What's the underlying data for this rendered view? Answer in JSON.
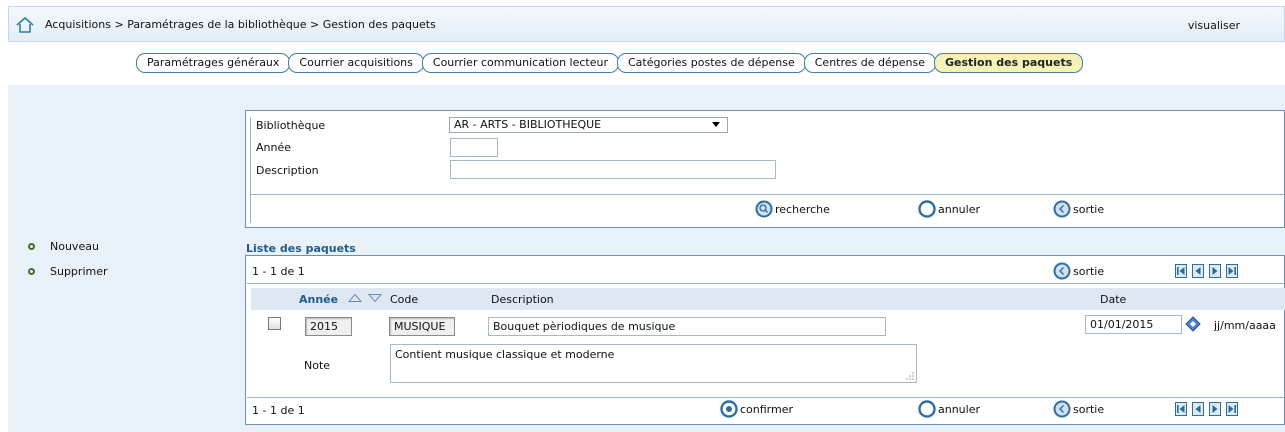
{
  "header": {
    "breadcrumb": "Acquisitions > Paramétrages de la bibliothèque > Gestion des paquets",
    "visualiser": "visualiser"
  },
  "tabs": [
    {
      "label": "Paramétrages généraux"
    },
    {
      "label": "Courrier acquisitions"
    },
    {
      "label": "Courrier communication lecteur"
    },
    {
      "label": "Catégories postes de dépense"
    },
    {
      "label": "Centres de dépense"
    },
    {
      "label": "Gestion des paquets",
      "active": true
    }
  ],
  "sidebar": {
    "items": [
      {
        "label": "Nouveau"
      },
      {
        "label": "Supprimer"
      }
    ]
  },
  "search": {
    "bibliotheque_label": "Bibliothèque",
    "bibliotheque_value": "AR - ARTS - BIBLIOTHEQUE",
    "annee_label": "Année",
    "annee_value": "",
    "description_label": "Description",
    "description_value": "",
    "actions": {
      "search": "recherche",
      "cancel": "annuler",
      "exit": "sortie"
    }
  },
  "list": {
    "title": "Liste des paquets",
    "count_top": "1 - 1 de 1",
    "count_bottom": "1 - 1 de 1",
    "exit_top": "sortie",
    "columns": {
      "annee": "Année",
      "code": "Code",
      "description": "Description",
      "date": "Date"
    },
    "rows": [
      {
        "annee": "2015",
        "code": "MUSIQUE",
        "description": "Bouquet pèriodiques de musique",
        "date": "01/01/2015",
        "date_format": "jj/mm/aaaa",
        "note_label": "Note",
        "note": "Contient musique classique et moderne"
      }
    ],
    "actions": {
      "confirm": "confirmer",
      "cancel": "annuler",
      "exit": "sortie"
    }
  },
  "colors": {
    "accent": "#1f5b8f",
    "tab_border": "#3f7fa8",
    "active_tab": "#f5f2b6",
    "band": "#e9f1f8",
    "bullet": "#3f6e2d"
  },
  "icons": {
    "home": "home-icon",
    "search": "search-circle-icon",
    "cancel": "circle-icon",
    "exit": "back-arrow-circle-icon",
    "confirm": "dot-circle-icon",
    "calendar": "calendar-icon",
    "pager": [
      "first-page-icon",
      "prev-page-icon",
      "next-page-icon",
      "last-page-icon"
    ]
  }
}
